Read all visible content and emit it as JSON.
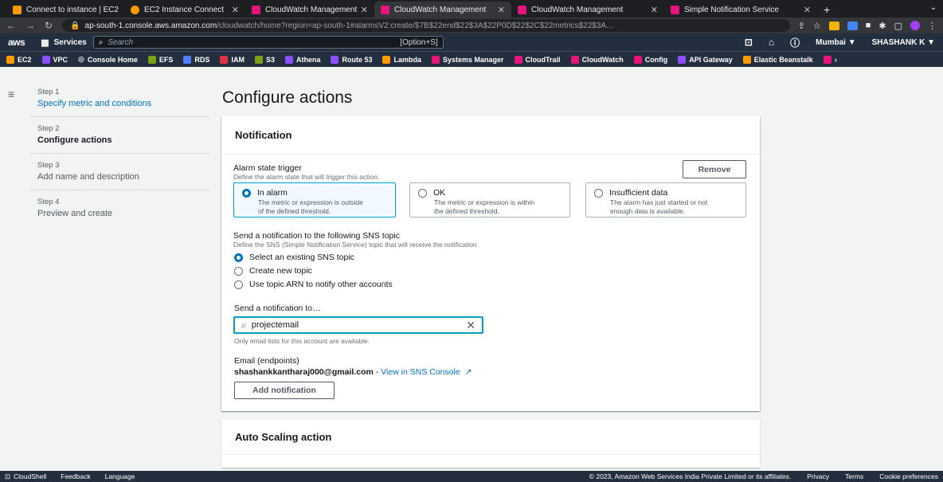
{
  "browser": {
    "tabs": [
      {
        "label": "Connect to instance | EC2 ",
        "color": "#ff9900"
      },
      {
        "label": "EC2 Instance Connect",
        "color": "#ff9900"
      },
      {
        "label": "CloudWatch Management",
        "color": "#e7157b"
      },
      {
        "label": "CloudWatch Management",
        "color": "#e7157b",
        "active": true
      },
      {
        "label": "CloudWatch Management",
        "color": "#e7157b"
      },
      {
        "label": "Simple Notification Service",
        "color": "#e7157b"
      }
    ],
    "new_tab": "+",
    "tab_menu": "⌄",
    "url_host": "ap-south-1.console.aws.amazon.com",
    "url_path": "/cloudwatch/home?region=ap-south-1#alarmsV2:create/$7B$22end$22$3A$22P0D$22$2C$22metrics$22$3A..."
  },
  "awsnav": {
    "logo": "aws",
    "services": "Services",
    "search_placeholder": "Search",
    "search_hint": "[Option+S]",
    "region": "Mumbai ▼",
    "user": "SHASHANK K ▼"
  },
  "favorites": [
    {
      "label": "EC2",
      "color": "#ff9900"
    },
    {
      "label": "VPC",
      "color": "#8c4fff"
    },
    {
      "label": "Console Home",
      "color": "#232f3e"
    },
    {
      "label": "EFS",
      "color": "#7aa116"
    },
    {
      "label": "RDS",
      "color": "#527fff"
    },
    {
      "label": "IAM",
      "color": "#dd344c"
    },
    {
      "label": "S3",
      "color": "#7aa116"
    },
    {
      "label": "Athena",
      "color": "#8c4fff"
    },
    {
      "label": "Route 53",
      "color": "#8c4fff"
    },
    {
      "label": "Lambda",
      "color": "#ff9900"
    },
    {
      "label": "Systems Manager",
      "color": "#e7157b"
    },
    {
      "label": "CloudTrail",
      "color": "#e7157b"
    },
    {
      "label": "CloudWatch",
      "color": "#e7157b"
    },
    {
      "label": "Config",
      "color": "#e7157b"
    },
    {
      "label": "API Gateway",
      "color": "#8c4fff"
    },
    {
      "label": "Elastic Beanstalk",
      "color": "#ff9900"
    }
  ],
  "steps": [
    {
      "num": "Step 1",
      "label": "Specify metric and conditions",
      "state": "link"
    },
    {
      "num": "Step 2",
      "label": "Configure actions",
      "state": "current"
    },
    {
      "num": "Step 3",
      "label": "Add name and description",
      "state": "dim"
    },
    {
      "num": "Step 4",
      "label": "Preview and create",
      "state": "dim"
    }
  ],
  "page_title": "Configure actions",
  "notification": {
    "header": "Notification",
    "trigger_label": "Alarm state trigger",
    "trigger_desc": "Define the alarm state that will trigger this action.",
    "remove": "Remove",
    "tiles": [
      {
        "title": "In alarm",
        "desc1": "The metric or expression is outside",
        "desc2": "of the defined threshold."
      },
      {
        "title": "OK",
        "desc1": "The metric or expression is within",
        "desc2": "the defined threshold."
      },
      {
        "title": "Insufficient data",
        "desc1": "The alarm has just started or not",
        "desc2": "enough data is available."
      }
    ],
    "sns_label": "Send a notification to the following SNS topic",
    "sns_desc": "Define the SNS (Simple Notification Service) topic that will receive the notification.",
    "options": [
      "Select an existing SNS topic",
      "Create new topic",
      "Use topic ARN to notify other accounts"
    ],
    "send_to_label": "Send a notification to…",
    "search_value": "projectemail",
    "search_hint": "Only email lists for this account are available.",
    "endpoints_label": "Email (endpoints)",
    "email": "shashankkantharaj000@gmail.com",
    "email_sep": " - ",
    "view_link": "View in SNS Console",
    "add_btn": "Add notification"
  },
  "autoscaling": {
    "header": "Auto Scaling action"
  },
  "footer": {
    "cloudshell": "CloudShell",
    "feedback": "Feedback",
    "language": "Language",
    "copyright": "© 2023, Amazon Web Services India Private Limited or its affiliates.",
    "privacy": "Privacy",
    "terms": "Terms",
    "cookies": "Cookie preferences"
  }
}
